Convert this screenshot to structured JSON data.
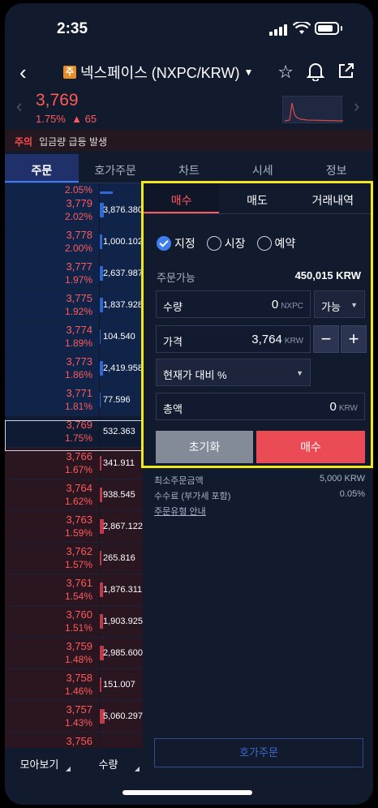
{
  "status": {
    "time": "2:35"
  },
  "header": {
    "badge": "주",
    "title": "넥스페이스 (NXPC/KRW)"
  },
  "ticker": {
    "price": "3,769",
    "change_pct": "1.75%",
    "change_abs": "▲ 65"
  },
  "notice": {
    "tag": "주의",
    "text": "입금량 급등 발생"
  },
  "tabs": [
    "주문",
    "호가주문",
    "차트",
    "시세",
    "정보"
  ],
  "orderbook": {
    "asks": [
      {
        "price": "",
        "pct": "2.05%",
        "qty": "",
        "fill": 0.3
      },
      {
        "price": "3,779",
        "pct": "2.02%",
        "qty": "3,876.380",
        "fill": 0.1
      },
      {
        "price": "3,778",
        "pct": "2.00%",
        "qty": "1,000.102",
        "fill": 0.06
      },
      {
        "price": "3,777",
        "pct": "1.97%",
        "qty": "2,637.987",
        "fill": 0.08
      },
      {
        "price": "3,775",
        "pct": "1.92%",
        "qty": "1,837.928",
        "fill": 0.07
      },
      {
        "price": "3,774",
        "pct": "1.89%",
        "qty": "104.540",
        "fill": 0.02
      },
      {
        "price": "3,773",
        "pct": "1.86%",
        "qty": "2,419.958",
        "fill": 0.08
      },
      {
        "price": "3,771",
        "pct": "1.81%",
        "qty": "77.596",
        "fill": 0.02
      }
    ],
    "current": {
      "price": "3,769",
      "pct": "1.75%",
      "qty": "532.363"
    },
    "bids": [
      {
        "price": "3,766",
        "pct": "1.67%",
        "qty": "341.911",
        "fill": 0.04
      },
      {
        "price": "3,764",
        "pct": "1.62%",
        "qty": "938.545",
        "fill": 0.06
      },
      {
        "price": "3,763",
        "pct": "1.59%",
        "qty": "2,867.122",
        "fill": 0.09
      },
      {
        "price": "3,762",
        "pct": "1.57%",
        "qty": "265.816",
        "fill": 0.03
      },
      {
        "price": "3,761",
        "pct": "1.54%",
        "qty": "1,876.311",
        "fill": 0.07
      },
      {
        "price": "3,760",
        "pct": "1.51%",
        "qty": "1,903.925",
        "fill": 0.07
      },
      {
        "price": "3,759",
        "pct": "1.48%",
        "qty": "2,985.600",
        "fill": 0.09
      },
      {
        "price": "3,758",
        "pct": "1.46%",
        "qty": "151.007",
        "fill": 0.03
      },
      {
        "price": "3,757",
        "pct": "1.43%",
        "qty": "5,060.297",
        "fill": 0.12
      },
      {
        "price": "3,756",
        "pct": "",
        "qty": "",
        "fill": 0
      }
    ],
    "footer": {
      "left": "모아보기",
      "right": "수량"
    }
  },
  "order": {
    "tabs": [
      "매수",
      "매도",
      "거래내역"
    ],
    "types": [
      "지정",
      "시장",
      "예약"
    ],
    "available_label": "주문가능",
    "available_value": "450,015 KRW",
    "qty_label": "수량",
    "qty_value": "0",
    "qty_unit": "NXPC",
    "qty_select": "가능",
    "price_label": "가격",
    "price_value": "3,764",
    "price_unit": "KRW",
    "minus": "−",
    "plus": "+",
    "pct_select": "현재가 대비 %",
    "total_label": "총액",
    "total_value": "0",
    "total_unit": "KRW",
    "reset_label": "초기화",
    "buy_label": "매수"
  },
  "info": {
    "min_label": "최소주문금액",
    "min_value": "5,000 KRW",
    "fee_label": "수수료 (부가세 포함)",
    "fee_value": "0.05%",
    "guide_link": "주문유형 안내"
  },
  "hoga_button": "호가주문"
}
